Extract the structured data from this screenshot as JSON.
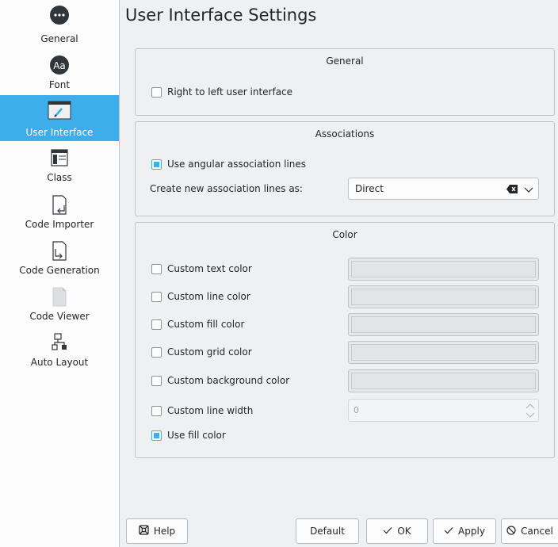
{
  "page_title": "User Interface Settings",
  "sidebar": {
    "items": [
      {
        "label": "General",
        "icon": "more-icon",
        "selected": false
      },
      {
        "label": "Font",
        "icon": "font-icon",
        "selected": false
      },
      {
        "label": "User Interface",
        "icon": "user-interface-icon",
        "selected": true
      },
      {
        "label": "Class",
        "icon": "class-icon",
        "selected": false
      },
      {
        "label": "Code Importer",
        "icon": "code-importer-icon",
        "selected": false
      },
      {
        "label": "Code Generation",
        "icon": "code-generation-icon",
        "selected": false
      },
      {
        "label": "Code Viewer",
        "icon": "code-viewer-icon",
        "selected": false
      },
      {
        "label": "Auto Layout",
        "icon": "auto-layout-icon",
        "selected": false
      }
    ],
    "font_icon_text": "Aa"
  },
  "general": {
    "title": "General",
    "right_to_left": {
      "label": "Right to left user interface",
      "checked": false
    }
  },
  "associations": {
    "title": "Associations",
    "angular_lines": {
      "label": "Use angular association lines",
      "checked": true
    },
    "create_label": "Create new association lines as:",
    "create_value": "Direct"
  },
  "color": {
    "title": "Color",
    "text_color": {
      "label": "Custom text color",
      "checked": false
    },
    "line_color": {
      "label": "Custom line color",
      "checked": false
    },
    "fill_color": {
      "label": "Custom fill color",
      "checked": false
    },
    "grid_color": {
      "label": "Custom grid color",
      "checked": false
    },
    "background_color": {
      "label": "Custom background color",
      "checked": false
    },
    "line_width": {
      "label": "Custom line width",
      "checked": false,
      "value": "0"
    },
    "use_fill": {
      "label": "Use fill color",
      "checked": true
    }
  },
  "buttons": {
    "help": "Help",
    "default": "Default",
    "ok": "OK",
    "apply": "Apply",
    "cancel": "Cancel"
  },
  "colors": {
    "accent": "#3daee9",
    "window_bg": "#eff0f1",
    "sidebar_bg": "#fcfcfc",
    "text": "#232629"
  }
}
